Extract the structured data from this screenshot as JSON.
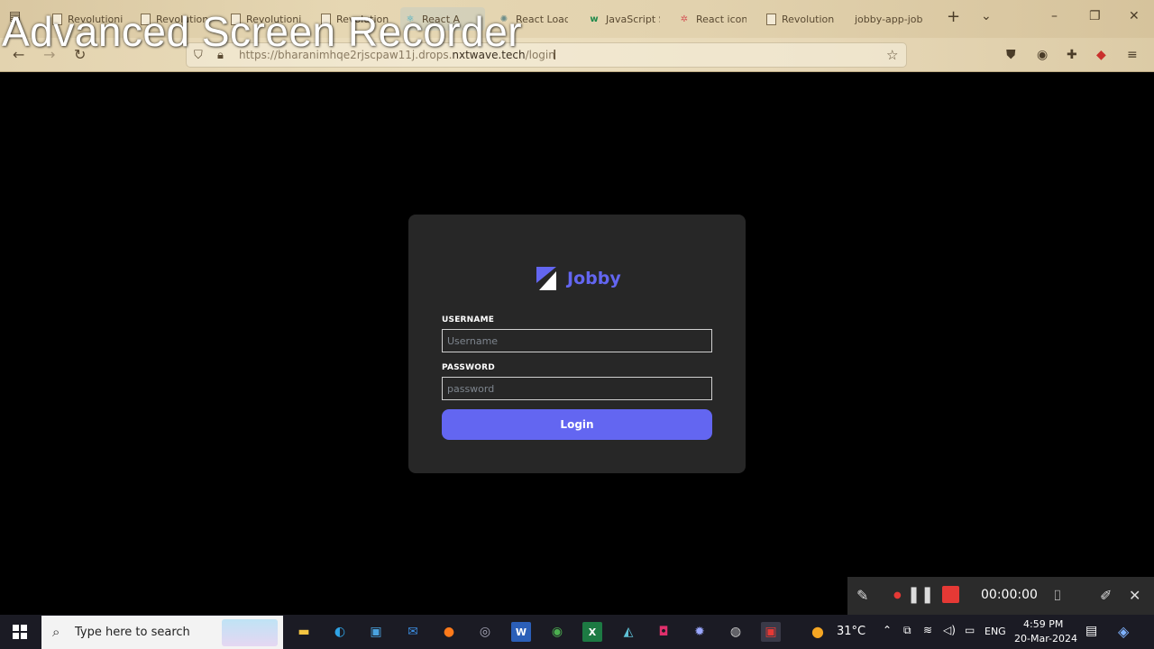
{
  "watermark": "Advanced Screen Recorder",
  "tabs": [
    {
      "label": "Revolutioni",
      "icon": "document-icon"
    },
    {
      "label": "Revolution",
      "icon": "document-icon"
    },
    {
      "label": "Revolutioni",
      "icon": "document-icon"
    },
    {
      "label": "Revolution",
      "icon": "document-icon"
    },
    {
      "label": "React A",
      "icon": "react-icon"
    },
    {
      "label": "React Load",
      "icon": "chatgpt-icon"
    },
    {
      "label": "JavaScript S",
      "icon": "w-icon"
    },
    {
      "label": "React icon",
      "icon": "react-icon"
    },
    {
      "label": "Revolution",
      "icon": "document-icon"
    },
    {
      "label": "jobby-app-job",
      "icon": ""
    }
  ],
  "address": {
    "prefix": "https://bharanimhqe2rjscpaw11j.drops.",
    "domain": "nxtwave.tech",
    "path": "/login"
  },
  "login": {
    "brand": "Jobby",
    "username_label": "USERNAME",
    "username_placeholder": "Username",
    "password_label": "PASSWORD",
    "password_placeholder": "password",
    "button": "Login",
    "accent": "#6366f1"
  },
  "recorder": {
    "timer": "00:00:00"
  },
  "taskbar": {
    "search_placeholder": "Type here to search",
    "weather": "31°C",
    "language": "ENG",
    "time": "4:59 PM",
    "date": "20-Mar-2024"
  }
}
